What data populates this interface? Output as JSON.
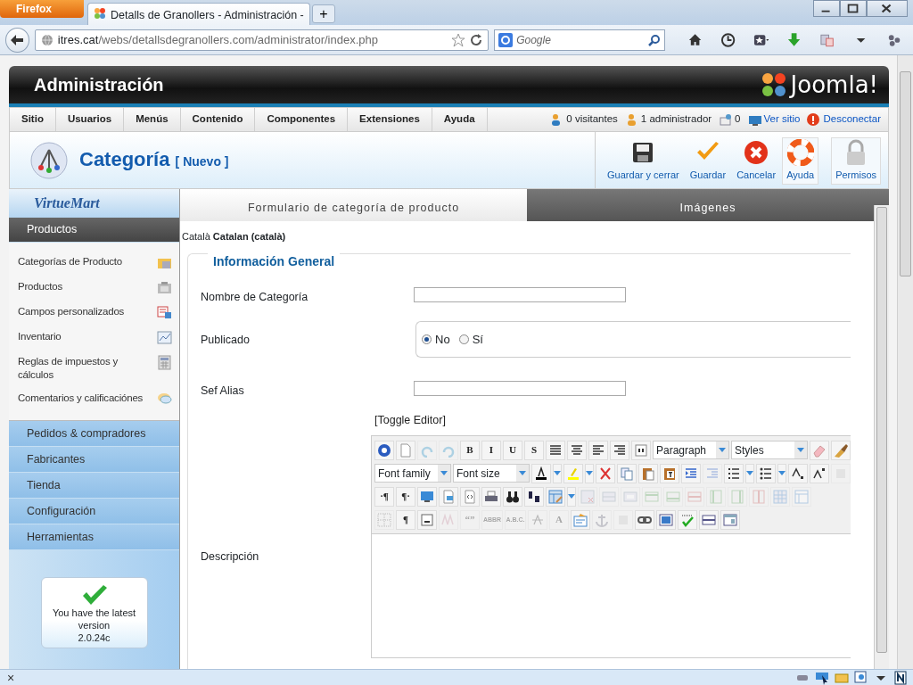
{
  "browser": {
    "menu_button": "Firefox",
    "tab_title": "Detalls de Granollers - Administración -",
    "new_tab": "+",
    "url_host": "itres.cat",
    "url_path": "/webs/detallsdegranollers.com/administrator/index.php",
    "search_placeholder": "Google"
  },
  "header": {
    "title": "Administración",
    "logo_text": "Joomla!"
  },
  "menu": {
    "items": [
      "Sitio",
      "Usuarios",
      "Menús",
      "Contenido",
      "Componentes",
      "Extensiones",
      "Ayuda"
    ],
    "status": [
      {
        "kind": "visitors",
        "text": "0 visitantes"
      },
      {
        "kind": "admins",
        "text": "1 administrador"
      },
      {
        "kind": "messages",
        "text": "0"
      },
      {
        "kind": "site",
        "text": "Ver sitio"
      },
      {
        "kind": "logout",
        "text": "Desconectar"
      }
    ]
  },
  "toolbar": {
    "title": "Categoría",
    "subtitle": "[ Nuevo ]",
    "buttons": [
      {
        "kind": "save-close",
        "label": "Guardar y cerrar"
      },
      {
        "kind": "save",
        "label": "Guardar"
      },
      {
        "kind": "cancel",
        "label": "Cancelar"
      },
      {
        "kind": "help",
        "label": "Ayuda"
      },
      {
        "kind": "permissions",
        "label": "Permisos"
      }
    ]
  },
  "sidebar": {
    "brand": "VirtueMart",
    "sections": [
      {
        "label": "Productos",
        "expanded": true,
        "items": [
          {
            "label": "Categorías de Producto"
          },
          {
            "label": "Productos"
          },
          {
            "label": "Campos personalizados"
          },
          {
            "label": "Inventario"
          },
          {
            "label": "Reglas de impuestos y cálculos"
          },
          {
            "label": "Comentarios y calificaciónes"
          }
        ]
      },
      {
        "label": "Pedidos & compradores",
        "expanded": false
      },
      {
        "label": "Fabricantes",
        "expanded": false
      },
      {
        "label": "Tienda",
        "expanded": false
      },
      {
        "label": "Configuración",
        "expanded": false
      },
      {
        "label": "Herramientas",
        "expanded": false
      }
    ],
    "version": {
      "message": "You have the latest version",
      "number": "2.0.24c"
    }
  },
  "tabs": [
    {
      "label": "Formulario de categoría de producto",
      "selected": true
    },
    {
      "label": "Imágenes",
      "selected": false
    }
  ],
  "language": "Català **Catalan (català)**",
  "form": {
    "legend": "Información General",
    "fields": [
      {
        "kind": "text",
        "label": "Nombre de Categoría"
      },
      {
        "kind": "radio",
        "label": "Publicado",
        "options": [
          {
            "label": "No",
            "selected": true
          },
          {
            "label": "Sí",
            "selected": false
          }
        ]
      },
      {
        "kind": "text",
        "label": "Sef Alias"
      },
      {
        "kind": "editor",
        "label": "Descripción",
        "toggle": "[Toggle Editor]",
        "toolbar": [
          [
            {
              "kind": "icon",
              "disabled": false
            },
            {
              "kind": "icon",
              "disabled": false
            },
            {
              "kind": "icon",
              "disabled": true
            },
            {
              "kind": "icon",
              "disabled": true
            },
            {
              "kind": "glyph",
              "text": "B",
              "disabled": false
            },
            {
              "kind": "glyph",
              "text": "I",
              "disabled": false
            },
            {
              "kind": "glyph",
              "text": "U",
              "disabled": false
            },
            {
              "kind": "glyph",
              "text": "S",
              "disabled": false
            },
            {
              "kind": "icon",
              "disabled": false
            },
            {
              "kind": "icon",
              "disabled": false
            },
            {
              "kind": "icon",
              "disabled": false
            },
            {
              "kind": "icon",
              "disabled": false
            },
            {
              "kind": "icon",
              "disabled": false
            },
            {
              "kind": "select",
              "text": "Paragraph"
            },
            {
              "kind": "select",
              "text": "Styles"
            },
            {
              "kind": "icon",
              "disabled": false
            },
            {
              "kind": "icon",
              "disabled": false
            }
          ],
          [
            {
              "kind": "select",
              "text": "Font family"
            },
            {
              "kind": "select",
              "text": "Font size"
            },
            {
              "kind": "icon",
              "disabled": false,
              "dropdown": true
            },
            {
              "kind": "icon",
              "disabled": false,
              "dropdown": true
            },
            {
              "kind": "icon",
              "disabled": false
            },
            {
              "kind": "icon",
              "disabled": false
            },
            {
              "kind": "icon",
              "disabled": false
            },
            {
              "kind": "icon",
              "disabled": false
            },
            {
              "kind": "icon",
              "disabled": false
            },
            {
              "kind": "icon",
              "disabled": true
            },
            {
              "kind": "icon",
              "disabled": false,
              "dropdown": true
            },
            {
              "kind": "icon",
              "disabled": false,
              "dropdown": true
            },
            {
              "kind": "icon",
              "disabled": false
            },
            {
              "kind": "icon",
              "disabled": false
            },
            {
              "kind": "icon",
              "disabled": true
            }
          ],
          [
            {
              "kind": "glyph",
              "text": "·¶",
              "disabled": false
            },
            {
              "kind": "glyph",
              "text": "¶·",
              "disabled": false
            },
            {
              "kind": "icon",
              "disabled": false
            },
            {
              "kind": "icon",
              "disabled": false
            },
            {
              "kind": "icon",
              "disabled": false
            },
            {
              "kind": "icon",
              "disabled": false
            },
            {
              "kind": "icon",
              "disabled": false
            },
            {
              "kind": "icon",
              "disabled": false
            },
            {
              "kind": "icon",
              "disabled": false,
              "dropdown": true
            },
            {
              "kind": "icon",
              "disabled": true
            },
            {
              "kind": "icon",
              "disabled": true
            },
            {
              "kind": "icon",
              "disabled": true
            },
            {
              "kind": "icon",
              "disabled": true
            },
            {
              "kind": "icon",
              "disabled": true
            },
            {
              "kind": "icon",
              "disabled": true
            },
            {
              "kind": "icon",
              "disabled": true
            },
            {
              "kind": "icon",
              "disabled": true
            },
            {
              "kind": "icon",
              "disabled": true
            },
            {
              "kind": "icon",
              "disabled": true
            },
            {
              "kind": "icon",
              "disabled": true
            }
          ],
          [
            {
              "kind": "icon",
              "disabled": true
            },
            {
              "kind": "glyph",
              "text": "¶",
              "disabled": false
            },
            {
              "kind": "icon",
              "disabled": false
            },
            {
              "kind": "icon",
              "disabled": true
            },
            {
              "kind": "glyph",
              "text": "“”",
              "disabled": true
            },
            {
              "kind": "glyph",
              "text": "ABBR",
              "disabled": true
            },
            {
              "kind": "glyph",
              "text": "A.B.C.",
              "disabled": true
            },
            {
              "kind": "icon",
              "disabled": true
            },
            {
              "kind": "glyph",
              "text": "A",
              "disabled": true
            },
            {
              "kind": "icon",
              "disabled": false
            },
            {
              "kind": "icon",
              "disabled": true
            },
            {
              "kind": "icon",
              "disabled": true
            },
            {
              "kind": "icon",
              "disabled": false
            },
            {
              "kind": "icon",
              "disabled": false
            },
            {
              "kind": "icon",
              "disabled": false
            },
            {
              "kind": "icon",
              "disabled": false
            },
            {
              "kind": "icon",
              "disabled": false
            }
          ]
        ]
      }
    ]
  },
  "status_bar": {
    "close": "×"
  }
}
